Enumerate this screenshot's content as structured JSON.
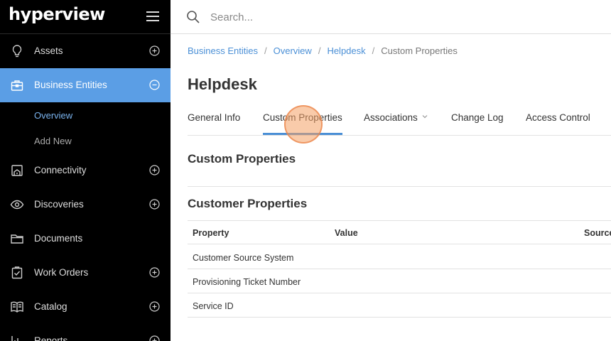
{
  "app": {
    "logo_text": "hyperview"
  },
  "sidebar": {
    "items": [
      {
        "label": "Assets",
        "icon": "lightbulb-icon",
        "toggle": "plus"
      },
      {
        "label": "Business Entities",
        "icon": "briefcase-icon",
        "toggle": "minus",
        "active": true
      },
      {
        "label": "Connectivity",
        "icon": "building-icon",
        "toggle": "plus"
      },
      {
        "label": "Discoveries",
        "icon": "eye-icon",
        "toggle": "plus"
      },
      {
        "label": "Documents",
        "icon": "folder-icon",
        "toggle": "none"
      },
      {
        "label": "Work Orders",
        "icon": "clipboard-check-icon",
        "toggle": "plus"
      },
      {
        "label": "Catalog",
        "icon": "book-icon",
        "toggle": "plus"
      },
      {
        "label": "Reports",
        "icon": "chart-icon",
        "toggle": "plus"
      }
    ],
    "sub_items": [
      {
        "label": "Overview",
        "active": true
      },
      {
        "label": "Add New"
      }
    ],
    "colors": {
      "background": "#000000",
      "active": "#5b9ee5"
    }
  },
  "search": {
    "placeholder": "Search..."
  },
  "breadcrumb": {
    "items": [
      "Business Entities",
      "Overview",
      "Helpdesk"
    ],
    "current": "Custom Properties"
  },
  "page": {
    "title": "Helpdesk"
  },
  "tabs": [
    {
      "label": "General Info"
    },
    {
      "label": "Custom Properties",
      "active": true
    },
    {
      "label": "Associations",
      "has_dropdown": true
    },
    {
      "label": "Change Log"
    },
    {
      "label": "Access Control"
    }
  ],
  "sections": {
    "custom_properties_title": "Custom Properties",
    "customer_properties_title": "Customer Properties"
  },
  "table": {
    "headers": {
      "property": "Property",
      "value": "Value",
      "source": "Source"
    },
    "rows": [
      {
        "property": "Customer Source System",
        "value": "",
        "source": ""
      },
      {
        "property": "Provisioning Ticket Number",
        "value": "",
        "source": ""
      },
      {
        "property": "Service ID",
        "value": "",
        "source": ""
      }
    ]
  },
  "accent_color": "#4a8fd6"
}
